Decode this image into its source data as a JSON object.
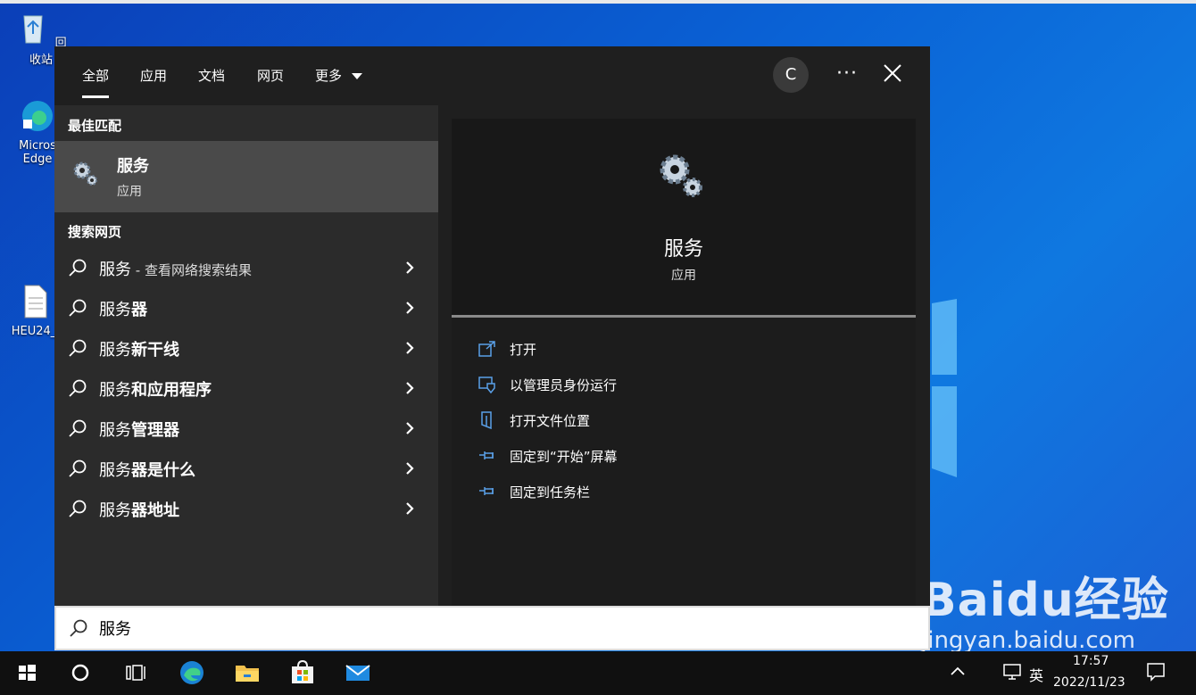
{
  "desktop": {
    "icons": [
      {
        "label": "回收站"
      },
      {
        "label": "Micros Edge"
      },
      {
        "label": "HEU24_"
      }
    ],
    "watermark": {
      "brand": "Baidu经验",
      "url": "jingyan.baidu.com"
    }
  },
  "search": {
    "tabs": [
      "全部",
      "应用",
      "文档",
      "网页",
      "更多"
    ],
    "user_initial": "C",
    "more_label": "···",
    "best_match_heading": "最佳匹配",
    "best_match": {
      "name": "服务",
      "type": "应用"
    },
    "web_heading": "搜索网页",
    "web_results": [
      {
        "prefix": "服务",
        "bold": "",
        "hint": " - 查看网络搜索结果"
      },
      {
        "prefix": "服务",
        "bold": "器",
        "hint": ""
      },
      {
        "prefix": "服务",
        "bold": "新干线",
        "hint": ""
      },
      {
        "prefix": "服务",
        "bold": "和应用程序",
        "hint": ""
      },
      {
        "prefix": "服务",
        "bold": "管理器",
        "hint": ""
      },
      {
        "prefix": "服务",
        "bold": "器是什么",
        "hint": ""
      },
      {
        "prefix": "服务",
        "bold": "器地址",
        "hint": ""
      }
    ],
    "preview": {
      "name": "服务",
      "type": "应用",
      "actions": [
        {
          "label": "打开",
          "icon": "open-icon"
        },
        {
          "label": "以管理员身份运行",
          "icon": "shield-icon"
        },
        {
          "label": "打开文件位置",
          "icon": "folder-icon"
        },
        {
          "label": "固定到“开始”屏幕",
          "icon": "pin-icon"
        },
        {
          "label": "固定到任务栏",
          "icon": "pin-icon"
        }
      ]
    },
    "query": "服务"
  },
  "taskbar": {
    "ime": "英",
    "time": "17:57",
    "date": "2022/11/23"
  },
  "colors": {
    "accent": "#5aa0e8",
    "panel": "#1f1f1f",
    "selected": "#4a4a4a"
  }
}
